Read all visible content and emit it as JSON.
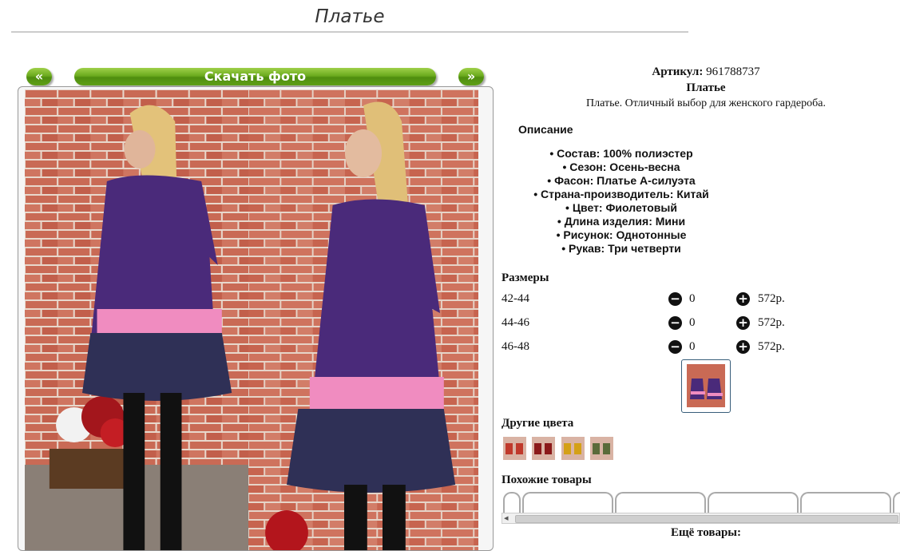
{
  "page": {
    "title": "Платье"
  },
  "gallery": {
    "prev_label": "«",
    "next_label": "»",
    "download_label": "Скачать фото"
  },
  "product": {
    "article_label": "Артикул:",
    "article_value": "961788737",
    "name": "Платье",
    "short_description": "Платье. Отличный выбор для женского гардероба.",
    "description_heading": "Описание",
    "features": [
      "Состав: 100% полиэстер",
      "Сезон: Осень-весна",
      "Фасон: Платье А-силуэта",
      "Страна-производитель: Китай",
      "Цвет: Фиолетовый",
      "Длина изделия: Мини",
      "Рисунок: Однотонные",
      "Рукав: Три четверти"
    ]
  },
  "sizes": {
    "heading": "Размеры",
    "rows": [
      {
        "size": "42-44",
        "qty": "0",
        "price": "572р."
      },
      {
        "size": "44-46",
        "qty": "0",
        "price": "572р."
      },
      {
        "size": "46-48",
        "qty": "0",
        "price": "572р."
      }
    ]
  },
  "colors": {
    "heading": "Другие цвета",
    "swatches": [
      "#c0392b",
      "#8b1a1a",
      "#d4a017",
      "#5a6b3a"
    ]
  },
  "similar": {
    "heading": "Похожие товары"
  },
  "more": {
    "heading": "Ещё товары:"
  },
  "palette": {
    "accent_green": "#6cab1e",
    "dress_purple": "#4a2a7a",
    "dress_pink": "#f08cc0",
    "dress_navy": "#2f3056",
    "brick": "#c96a55"
  }
}
